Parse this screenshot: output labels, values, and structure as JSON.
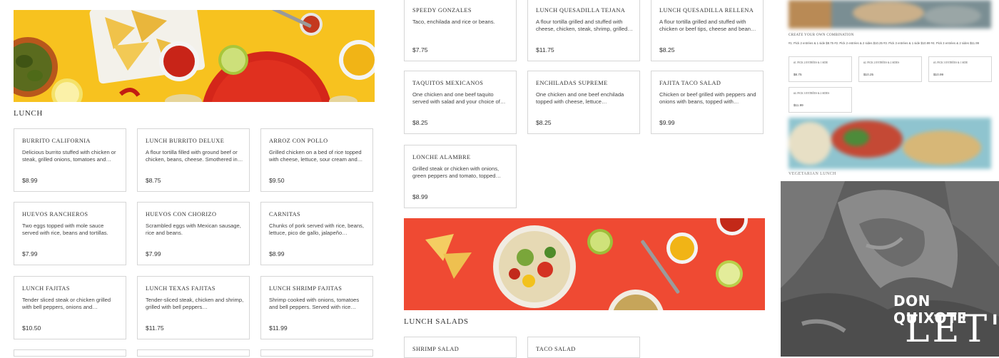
{
  "col1": {
    "section_title": "LUNCH",
    "items": [
      {
        "name": "BURRITO CALIFORNIA",
        "desc": "Delicious burrito stuffed with chicken or steak, grilled onions, tomatoes and…",
        "price": "$8.99"
      },
      {
        "name": "LUNCH BURRITO DELUXE",
        "desc": "A flour tortilla filled with ground beef or chicken, beans, cheese. Smothered in…",
        "price": "$8.75"
      },
      {
        "name": "ARROZ CON POLLO",
        "desc": "Grilled chicken on a bed of rice topped with cheese, lettuce, sour cream and…",
        "price": "$9.50"
      },
      {
        "name": "HUEVOS RANCHEROS",
        "desc": "Two eggs topped with mole sauce served with rice, beans and tortillas.",
        "price": "$7.99"
      },
      {
        "name": "HUEVOS CON CHORIZO",
        "desc": "Scrambled eggs with Mexican sausage, rice and beans.",
        "price": "$7.99"
      },
      {
        "name": "CARNITAS",
        "desc": "Chunks of pork served with rice, beans, lettuce, pico de gallo, jalapeño…",
        "price": "$8.99"
      },
      {
        "name": "LUNCH FAJITAS",
        "desc": "Tender sliced steak or chicken grilled with bell peppers, onions and…",
        "price": "$10.50"
      },
      {
        "name": "LUNCH TEXAS FAJITAS",
        "desc": "Tender-sliced steak, chicken and shrimp, grilled with bell peppers…",
        "price": "$11.75"
      },
      {
        "name": "LUNCH SHRIMP FAJITAS",
        "desc": "Shrimp cooked with onions, tomatoes and bell peppers. Served with rice…",
        "price": "$11.99"
      }
    ]
  },
  "col2": {
    "items": [
      {
        "name": "SPEEDY GONZALES",
        "desc": "Taco, enchilada and rice or beans.",
        "price": "$7.75"
      },
      {
        "name": "LUNCH QUESADILLA TEJANA",
        "desc": "A flour tortilla grilled and stuffed with cheese, chicken, steak, shrimp, grilled…",
        "price": "$11.75"
      },
      {
        "name": "LUNCH QUESADILLA RELLENA",
        "desc": "A flour tortilla grilled and stuffed with chicken or beef tips, cheese and bean…",
        "price": "$8.25"
      },
      {
        "name": "TAQUITOS MEXICANOS",
        "desc": "One chicken and one beef taquito served with salad and your choice of…",
        "price": "$8.25"
      },
      {
        "name": "ENCHILADAS SUPREME",
        "desc": "One chicken and one beef enchilada topped with cheese, lettuce…",
        "price": "$8.25"
      },
      {
        "name": "FAJITA TACO SALAD",
        "desc": "Chicken or beef grilled with peppers and onions with beans, topped with…",
        "price": "$9.99"
      },
      {
        "name": "LONCHE ALAMBRE",
        "desc": "Grilled steak or chicken with onions, green peppers and tomato, topped…",
        "price": "$8.99"
      }
    ],
    "salads_title": "LUNCH SALADS",
    "salads": [
      {
        "name": "SHRIMP SALAD"
      },
      {
        "name": "TACO SALAD"
      }
    ]
  },
  "col3": {
    "combo_title": "CREATE YOUR OWN COMBINATION",
    "combo_desc": "#1. Pick 2 entrées & 1 side $8.75 #2. Pick 2 entrées & 2 sides $10.25 #3. Pick 3 entrées & 1 side $10.99 #4. Pick 3 entrées & 2 sides $11.99",
    "combos": [
      {
        "name": "#1. PICK 2 ENTRÉES & 1 SIDE",
        "price": "$8.75"
      },
      {
        "name": "#2. PICK 2 ENTRÉES & 2 SIDES",
        "price": "$10.25"
      },
      {
        "name": "#3. PICK 3 ENTRÉES & 1 SIDE",
        "price": "$10.99"
      },
      {
        "name": "#4. PICK 3 ENTRÉES & 2 SIDES",
        "price": "$11.99"
      }
    ],
    "veg_title": "VEGETARIAN LUNCH",
    "promo_brand": "DON QUIXOTE",
    "promo_headline": "LET'S E"
  }
}
